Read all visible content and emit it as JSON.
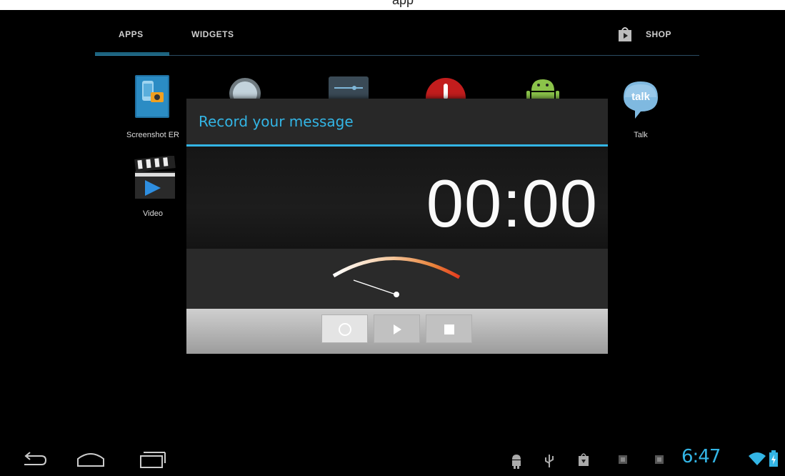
{
  "top_strip": {
    "partial_text": "app"
  },
  "tabs": {
    "apps": "APPS",
    "widgets": "WIDGETS",
    "shop": "SHOP"
  },
  "apps": [
    {
      "label": "Screenshot ER",
      "icon": "screenshot-er-icon"
    },
    {
      "label": "",
      "icon": "search-app-icon"
    },
    {
      "label": "",
      "icon": "settings-app-icon"
    },
    {
      "label": "",
      "icon": "sound-recorder-app-icon"
    },
    {
      "label": "",
      "icon": "android-app-icon"
    },
    {
      "label": "Talk",
      "icon": "talk-icon"
    },
    {
      "label": "Video",
      "icon": "video-icon"
    }
  ],
  "talk_icon_text": "talk",
  "dialog": {
    "title": "Record your message",
    "timer": "00:00",
    "controls": {
      "record": "record-icon",
      "play": "play-icon",
      "stop": "stop-icon"
    }
  },
  "status_bar": {
    "time": "6:47"
  },
  "colors": {
    "accent": "#33b5e5",
    "meter_start": "#ffffff",
    "meter_end": "#e53a1e"
  }
}
